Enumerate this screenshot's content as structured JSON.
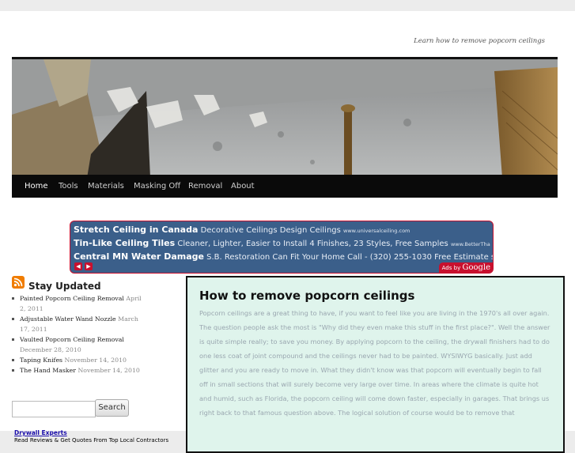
{
  "site": {
    "tagline": "Learn how to remove popcorn ceilings"
  },
  "nav": {
    "items": [
      {
        "label": "Home",
        "active": true
      },
      {
        "label": "Tools",
        "active": false
      },
      {
        "label": "Materials",
        "active": false
      },
      {
        "label": "Masking Off",
        "active": false
      },
      {
        "label": "Removal",
        "active": false
      },
      {
        "label": "About",
        "active": false
      }
    ]
  },
  "ads": {
    "items": [
      {
        "title": "Stretch Ceiling in Canada",
        "text": "Decorative Ceilings Design Ceilings",
        "url": "www.universalceiling.com"
      },
      {
        "title": "Tin-Like Ceiling Tiles",
        "text": "Cleaner, Lighter, Easier to Install 4 Finishes, 23 Styles, Free Samples",
        "url": "www.BetterTha"
      },
      {
        "title": "Central MN Water Damage",
        "text": "S.B. Restoration Can Fit Your Home Call - (320) 255-1030 Free Estimate s",
        "url": ""
      }
    ],
    "ads_by_prefix": "Ads by",
    "ads_by_brand": "Google",
    "accent_color": "#c8102e",
    "background_color": "#3b5f8a"
  },
  "sidebar": {
    "widget_title": "Stay Updated",
    "posts": [
      {
        "title": "Painted Popcorn Ceiling Removal",
        "date": "April 2, 2011"
      },
      {
        "title": "Adjustable Water Wand Nozzle",
        "date": "March 17, 2011"
      },
      {
        "title": "Vaulted Popcorn Ceiling Removal",
        "date": "December 28, 2010"
      },
      {
        "title": "Taping Knifes",
        "date": "November 14, 2010"
      },
      {
        "title": "The Hand Masker",
        "date": "November 14, 2010"
      }
    ],
    "search": {
      "placeholder": "",
      "button_label": "Search"
    },
    "sponsor": {
      "title": "Drywall Experts",
      "text": "Read Reviews & Get Quotes From Top Local Contractors"
    }
  },
  "article": {
    "title": "How to remove popcorn ceilings",
    "body": "Popcorn ceilings are a great thing to have,  if you want to feel like you are living in the 1970's all over again.  The question people ask the most is \"Why did they even make this stuff in the first place?\".  Well the answer is quite simple really; to save you money.  By applying popcorn to the ceiling,  the drywall finishers had to do one less coat of joint compound and the ceilings never had to be painted.  WYSIWYG basically.  Just add glitter and you are ready to move in.  What they didn't know was that popcorn will eventually  begin to fall off in small sections that will surely become very large over time.  In areas where the climate is quite hot and humid, such as Florida, the popcorn ceiling will come down faster, especially in garages.  That brings us right back to that famous question above.  The logical solution of course would be to remove that",
    "background_color": "#dff4ec"
  },
  "icons": {
    "rss": "rss-feed-icon",
    "ad_prev": "chevron-left-icon",
    "ad_next": "chevron-right-icon"
  }
}
